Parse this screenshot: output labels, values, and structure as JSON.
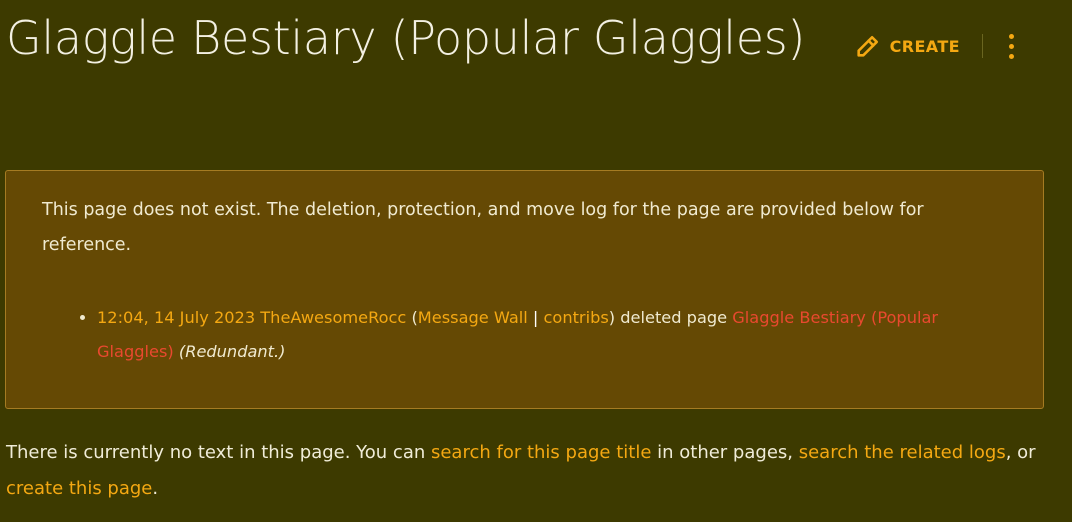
{
  "page": {
    "title": "Glaggle Bestiary (Popular Glaggles)"
  },
  "actions": {
    "create_label": "CREATE",
    "create_icon": "pencil-icon",
    "more_icon": "kebab-menu-icon"
  },
  "notice": {
    "message": "This page does not exist. The deletion, protection, and move log for the page are provided below for reference.",
    "log_entries": [
      {
        "timestamp": "12:04, 14 July 2023",
        "user": "TheAwesomeRocc",
        "open_paren": " (",
        "message_wall": "Message Wall",
        "separator": " | ",
        "contribs": "contribs",
        "action": ") deleted page ",
        "page": "Glaggle Bestiary (Popular Glaggles)",
        "space": " ",
        "reason": "(Redundant.)"
      }
    ]
  },
  "footer": {
    "prefix": "There is currently no text in this page. You can ",
    "search_title_link": "search for this page title",
    "middle": " in other pages, ",
    "search_logs_link": "search the related logs",
    "or_text": ", or ",
    "create_link": "create this page",
    "suffix": "."
  },
  "colors": {
    "background": "#3d3a00",
    "notice_background": "#654904",
    "notice_border": "#a57b22",
    "link": "#f4a812",
    "redlink": "#e9492f",
    "text": "#f0ecd8"
  }
}
